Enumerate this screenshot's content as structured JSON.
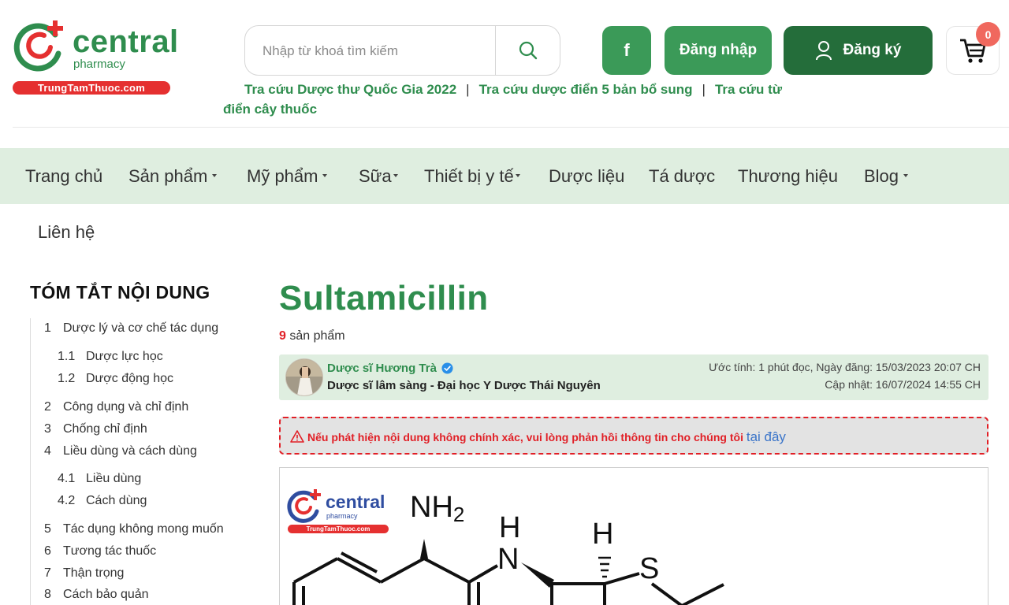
{
  "header": {
    "logo": {
      "word": "central",
      "sub": "pharmacy",
      "bar": "TrungTamThuoc.com"
    },
    "search": {
      "placeholder": "Nhập từ khoá tìm kiếm",
      "icon": "search-icon"
    },
    "quick_links": [
      "Tra cứu Dược thư Quốc Gia 2022",
      "Tra cứu dược điển 5 bản bổ sung",
      "Tra cứu từ điển cây thuốc"
    ],
    "facebook_label": "f",
    "login_label": "Đăng nhập",
    "register_label": "Đăng ký",
    "cart_count": "0"
  },
  "nav": {
    "items": [
      {
        "label": "Trang chủ",
        "dropdown": false
      },
      {
        "label": "Sản phẩm",
        "dropdown": true
      },
      {
        "label": "Mỹ phẩm",
        "dropdown": true
      },
      {
        "label": "Sữa",
        "dropdown": true
      },
      {
        "label": "Thiết bị y tế",
        "dropdown": true
      },
      {
        "label": "Dược liệu",
        "dropdown": false
      },
      {
        "label": "Tá dược",
        "dropdown": false
      },
      {
        "label": "Thương hiệu",
        "dropdown": false
      },
      {
        "label": "Blog",
        "dropdown": true
      }
    ],
    "second_row": "Liên hệ"
  },
  "toc": {
    "title": "TÓM TẮT NỘI DUNG",
    "items": [
      {
        "num": "1",
        "label": "Dược lý và cơ chế tác dụng"
      },
      {
        "num": "1.1",
        "label": "Dược lực học"
      },
      {
        "num": "1.2",
        "label": "Dược động học"
      },
      {
        "num": "2",
        "label": "Công dụng và chỉ định"
      },
      {
        "num": "3",
        "label": "Chống chỉ định"
      },
      {
        "num": "4",
        "label": "Liều dùng và cách dùng"
      },
      {
        "num": "4.1",
        "label": "Liều dùng"
      },
      {
        "num": "4.2",
        "label": "Cách dùng"
      },
      {
        "num": "5",
        "label": "Tác dụng không mong muốn"
      },
      {
        "num": "6",
        "label": "Tương tác thuốc"
      },
      {
        "num": "7",
        "label": "Thận trọng"
      },
      {
        "num": "8",
        "label": "Cách bảo quản"
      }
    ]
  },
  "article": {
    "title": "Sultamicillin",
    "product_count": "9",
    "product_suffix": "sản phẩm",
    "author": {
      "name": "Dược sĩ Hương Trà",
      "role": "Dược sĩ lâm sàng - Đại học Y Dược Thái Nguyên",
      "meta_line1": "Ước tính: 1 phút đọc, Ngày đăng: 15/03/2023 20:07 CH",
      "meta_line2": "Cập nhật: 16/07/2024 14:55 CH"
    },
    "warning": {
      "text": "Nếu phát hiện nội dung không chính xác, vui lòng phản hồi thông tin cho chúng tôi",
      "link": "tại đây"
    },
    "figure": {
      "logo_word": "central",
      "logo_sub": "pharmacy",
      "logo_bar": "TrungTamThuoc.com",
      "atoms": {
        "nh2": "NH",
        "nh2_sub": "2",
        "h1": "H",
        "n": "N",
        "h2": "H",
        "s": "S"
      }
    }
  },
  "colors": {
    "brand_green": "#2f8d4e",
    "dark_green": "#246d3a",
    "nav_bg": "#dfeee0",
    "alert_red": "#e11f26",
    "logo_red": "#e53030"
  }
}
